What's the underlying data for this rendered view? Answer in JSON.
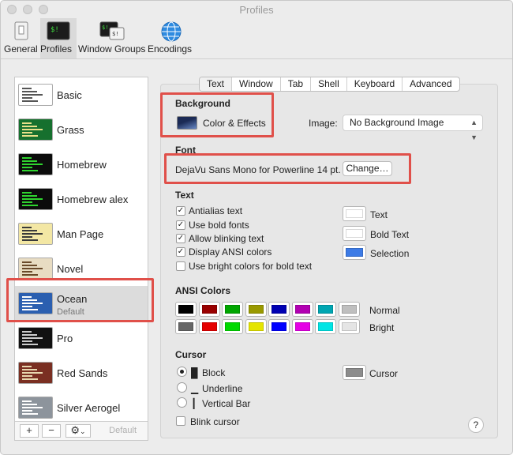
{
  "window": {
    "title": "Profiles"
  },
  "toolbar": {
    "items": [
      {
        "label": "General"
      },
      {
        "label": "Profiles"
      },
      {
        "label": "Window Groups"
      },
      {
        "label": "Encodings"
      }
    ]
  },
  "profiles": {
    "items": [
      {
        "name": "Basic",
        "colors": {
          "bg": "#ffffff",
          "fg": "#555555"
        }
      },
      {
        "name": "Grass",
        "colors": {
          "bg": "#16702e",
          "fg": "#e9e08a"
        }
      },
      {
        "name": "Homebrew",
        "colors": {
          "bg": "#0c0c0c",
          "fg": "#2fd42f"
        }
      },
      {
        "name": "Homebrew alex",
        "colors": {
          "bg": "#0c0c0c",
          "fg": "#2fd42f"
        }
      },
      {
        "name": "Man Page",
        "colors": {
          "bg": "#f3e7a4",
          "fg": "#3a3a3a"
        }
      },
      {
        "name": "Novel",
        "colors": {
          "bg": "#e8dcc2",
          "fg": "#6a4a2a"
        }
      },
      {
        "name": "Ocean",
        "subtitle": "Default",
        "colors": {
          "bg": "#2b5fb0",
          "fg": "#ffffff"
        }
      },
      {
        "name": "Pro",
        "colors": {
          "bg": "#111111",
          "fg": "#cccccc"
        }
      },
      {
        "name": "Red Sands",
        "colors": {
          "bg": "#7a2f22",
          "fg": "#e8d8b0"
        }
      },
      {
        "name": "Silver Aerogel",
        "colors": {
          "bg": "#8d949c",
          "fg": "#ffffff"
        }
      }
    ],
    "footer": {
      "add": "+",
      "remove": "−",
      "gear": "⚙",
      "gear_caret": "⌄",
      "default_label": "Default"
    }
  },
  "tabs": [
    "Text",
    "Window",
    "Tab",
    "Shell",
    "Keyboard",
    "Advanced"
  ],
  "background": {
    "heading": "Background",
    "color_effects_label": "Color & Effects",
    "image_label": "Image:",
    "image_value": "No Background Image"
  },
  "font": {
    "heading": "Font",
    "value": "DejaVu Sans Mono for Powerline 14 pt.",
    "change_label": "Change…"
  },
  "text": {
    "heading": "Text",
    "options": [
      {
        "label": "Antialias text",
        "checked": true
      },
      {
        "label": "Use bold fonts",
        "checked": true
      },
      {
        "label": "Allow blinking text",
        "checked": true
      },
      {
        "label": "Display ANSI colors",
        "checked": true
      },
      {
        "label": "Use bright colors for bold text",
        "checked": false
      }
    ],
    "wells": [
      {
        "label": "Text",
        "color": "#ffffff"
      },
      {
        "label": "Bold Text",
        "color": "#ffffff"
      },
      {
        "label": "Selection",
        "color": "#3d7be6"
      }
    ]
  },
  "ansi": {
    "heading": "ANSI Colors",
    "normal_label": "Normal",
    "bright_label": "Bright",
    "normal": [
      "#000000",
      "#990000",
      "#00a600",
      "#999900",
      "#0000b2",
      "#b200b2",
      "#00a6b2",
      "#bfbfbf"
    ],
    "bright": [
      "#666666",
      "#e50000",
      "#00d900",
      "#e5e500",
      "#0000ff",
      "#e500e5",
      "#00e5e5",
      "#e5e5e5"
    ]
  },
  "cursor": {
    "heading": "Cursor",
    "options": [
      {
        "label": "Block",
        "glyph": "█",
        "selected": true
      },
      {
        "label": "Underline",
        "glyph": "▁",
        "selected": false
      },
      {
        "label": "Vertical Bar",
        "glyph": "┃",
        "selected": false
      }
    ],
    "blink_label": "Blink cursor",
    "blink_checked": false,
    "well_label": "Cursor",
    "well_color": "#8c8c8c"
  },
  "help": {
    "glyph": "?"
  },
  "colors": {
    "highlight": "#e0504a"
  }
}
